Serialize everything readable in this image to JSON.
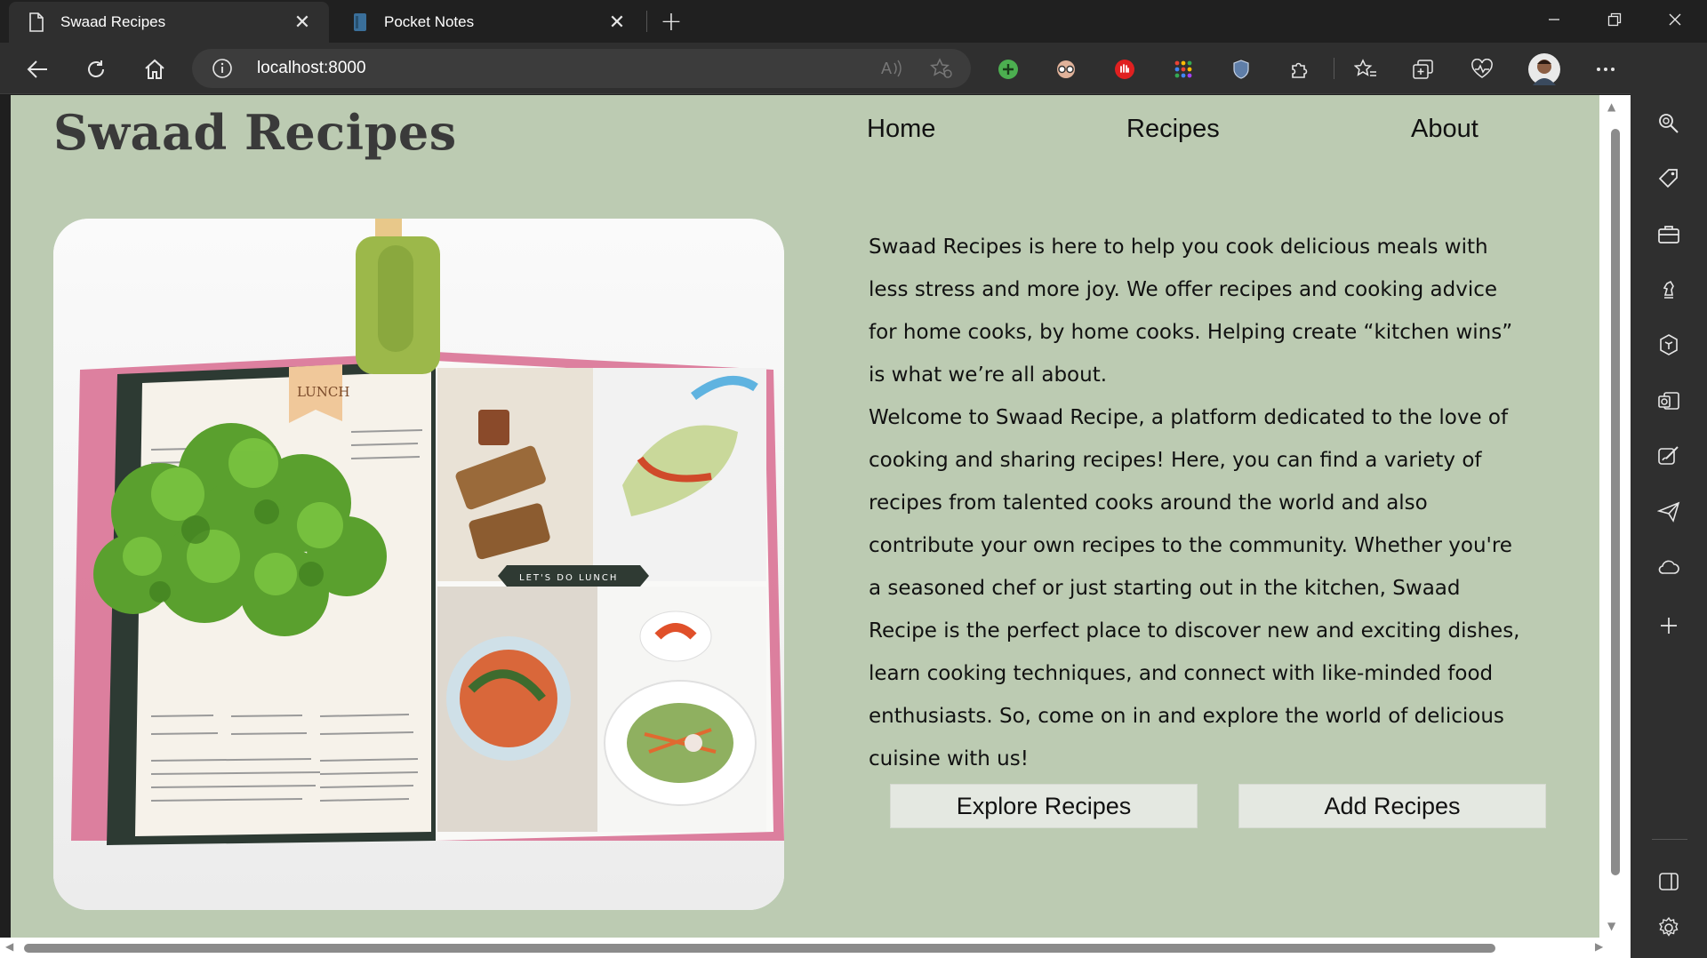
{
  "browser": {
    "tabs": [
      {
        "title": "Swaad Recipes",
        "active": true
      },
      {
        "title": "Pocket Notes",
        "active": false
      }
    ],
    "address": {
      "url": "localhost:8000"
    },
    "extensions": [
      "plus-circle-icon",
      "glasses-icon",
      "hand-stop-icon",
      "grid-dots-icon",
      "shield-icon"
    ],
    "sidebar_icons": [
      "search-icon",
      "tag-icon",
      "briefcase-icon",
      "chess-icon",
      "office-icon",
      "outlook-icon",
      "designer-icon",
      "send-icon",
      "cloud-icon",
      "plus-icon",
      "panel-icon",
      "settings-icon"
    ]
  },
  "site": {
    "title": "Swaad Recipes",
    "nav": {
      "home": "Home",
      "recipes": "Recipes",
      "about": "About"
    },
    "intro_p1": "Swaad Recipes is here to help you cook delicious meals with less stress and more joy. We offer recipes and cooking advice for home cooks, by home cooks. Helping create “kitchen wins” is what we’re all about.",
    "intro_p2": "Welcome to Swaad Recipe, a platform dedicated to the love of cooking and sharing recipes! Here, you can find a variety of recipes from talented cooks around the world and also contribute your own recipes to the community. Whether you're a seasoned chef or just starting out in the kitchen, Swaad Recipe is the perfect place to discover new and exciting dishes, learn cooking techniques, and connect with like-minded food enthusiasts. So, come on in and explore the world of delicious cuisine with us!",
    "buttons": {
      "explore": "Explore Recipes",
      "add": "Add Recipes"
    },
    "hero": {
      "page_tag": "LUNCH",
      "banner": "LET'S DO LUNCH"
    }
  },
  "colors": {
    "page_bg": "#bccbb2",
    "chrome_dark": "#202020",
    "toolbar": "#2f2f2f",
    "button_bg": "#e4e8e1"
  }
}
